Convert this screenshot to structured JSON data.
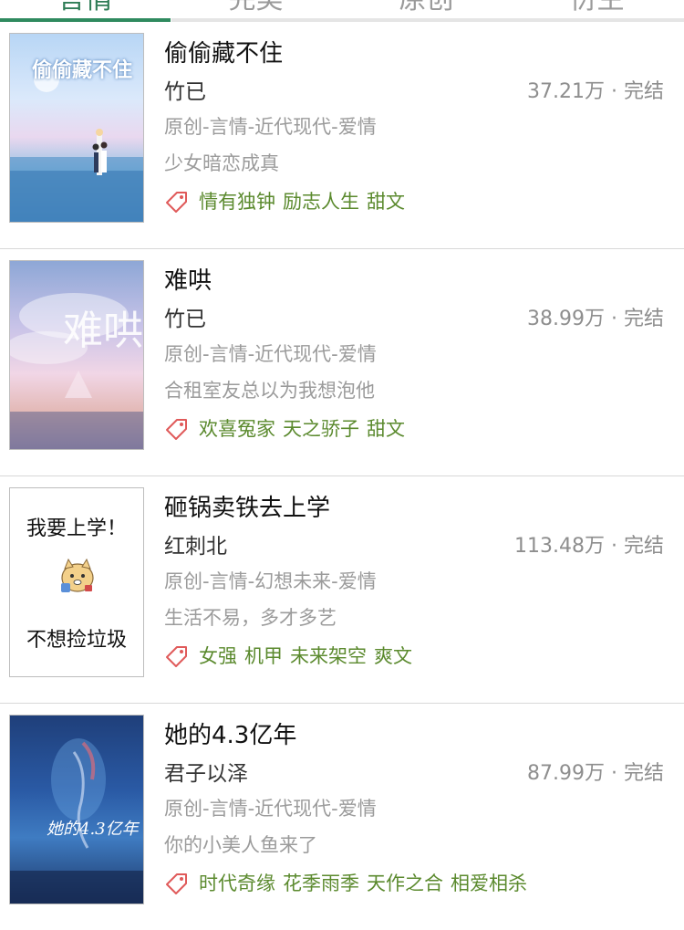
{
  "tabs": [
    {
      "label": "言情",
      "active": true
    },
    {
      "label": "完美",
      "active": false
    },
    {
      "label": "原创",
      "active": false
    },
    {
      "label": "衍生",
      "active": false
    }
  ],
  "books": [
    {
      "title": "偷偷藏不住",
      "author": "竹已",
      "stats": "37.21万 · 完结",
      "category": "原创-言情-近代现代-爱情",
      "intro": "少女暗恋成真",
      "tags": [
        "情有独钟",
        "励志人生",
        "甜文"
      ],
      "cover_text": "偷偷藏不住"
    },
    {
      "title": "难哄",
      "author": "竹已",
      "stats": "38.99万 · 完结",
      "category": "原创-言情-近代现代-爱情",
      "intro": "合租室友总以为我想泡他",
      "tags": [
        "欢喜冤家",
        "天之骄子",
        "甜文"
      ],
      "cover_text": "难哄"
    },
    {
      "title": "砸锅卖铁去上学",
      "author": "红刺北",
      "stats": "113.48万 · 完结",
      "category": "原创-言情-幻想未来-爱情",
      "intro": "生活不易，多才多艺",
      "tags": [
        "女强",
        "机甲",
        "未来架空",
        "爽文"
      ],
      "cover_line1": "我要上学！",
      "cover_line2": "不想捡垃圾"
    },
    {
      "title": "她的4.3亿年",
      "author": "君子以泽",
      "stats": "87.99万 · 完结",
      "category": "原创-言情-近代现代-爱情",
      "intro": "你的小美人鱼来了",
      "tags": [
        "时代奇缘",
        "花季雨季",
        "天作之合",
        "相爱相杀"
      ],
      "cover_text": "她的4.3亿年"
    }
  ],
  "colors": {
    "accent": "#2f8a5f",
    "tag_text": "#5b8a2e",
    "tag_icon": "#e05a5a",
    "muted": "#9b9b9b"
  }
}
